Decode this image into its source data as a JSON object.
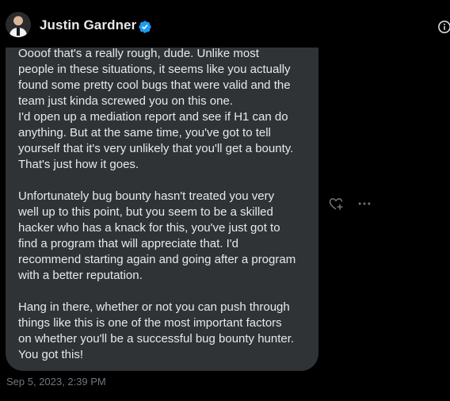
{
  "sender": {
    "name": "Justin Gardner",
    "avatar_icon": "profile-photo",
    "verified_icon": "verified-badge-icon",
    "verified_color": "#1d9bf0"
  },
  "header": {
    "info_icon": "info-icon"
  },
  "message": {
    "text": "Oooof that's a really rough, dude. Unlike most\npeople in these situations, it seems like you actually\nfound some pretty cool bugs that were valid and the\nteam just kinda screwed you on this one.\nI'd open up a mediation report and see if H1 can do\nanything. But at the same time, you've got to tell\nyourself that it's very unlikely that you'll get a bounty.\nThat's just how it goes.\n\nUnfortunately bug bounty hasn't treated you very\nwell up to this point, but you seem to be a skilled\nhacker who has a knack for this, you've just got to\nfind a program that will appreciate that. I'd\nrecommend starting again and going after a program\nwith a better reputation.\n\nHang in there, whether or not you can push through\nthings like this is one of the most important factors\non whether you'll be a successful bug bounty hunter.\nYou got this!",
    "timestamp": "Sep 5, 2023, 2:39 PM",
    "bubble_color": "#2f3336"
  },
  "actions": {
    "react_icon": "heart-add-icon",
    "more_icon": "more-horizontal-icon"
  }
}
